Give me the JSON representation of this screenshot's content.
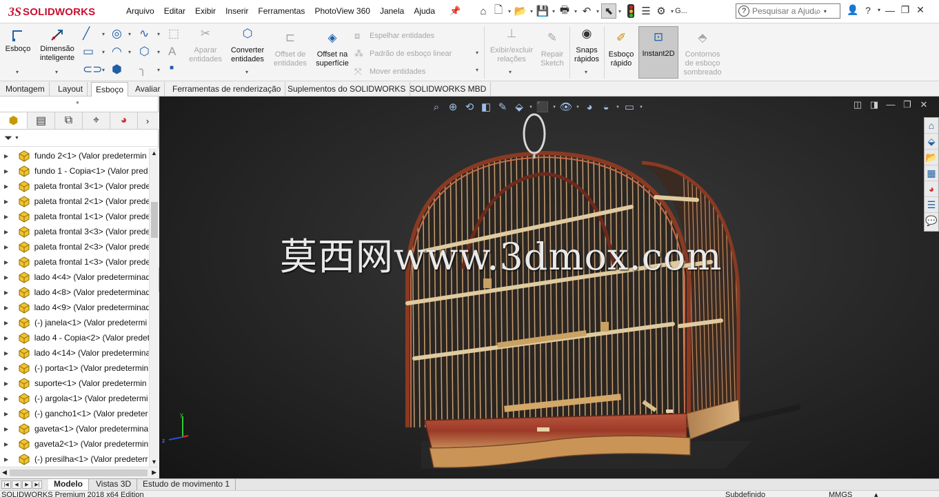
{
  "app": {
    "logo_ds": "3S",
    "logo_name": "SOLIDWORKS"
  },
  "menu": [
    "Arquivo",
    "Editar",
    "Exibir",
    "Inserir",
    "Ferramentas",
    "PhotoView 360",
    "Janela",
    "Ajuda"
  ],
  "search": {
    "placeholder": "Pesquisar a Ajuda"
  },
  "quick_access_trailing": "G...",
  "ribbon": {
    "esboco": "Esboço",
    "dimensao": "Dimensão inteligente",
    "aparar": "Aparar entidades",
    "converter": "Converter entidades",
    "offset_entidades": "Offset de entidades",
    "offset_superficie": "Offset na superfície",
    "espelhar": "Espelhar entidades",
    "padrao": "Padrão de esboço linear",
    "mover": "Mover entidades",
    "exibir_relacoes": "Exibir/excluir relações",
    "repair": "Repair Sketch",
    "snaps": "Snaps rápidos",
    "esboco_rapido": "Esboço rápido",
    "instant2d": "Instant2D",
    "contornos": "Contornos de esboço sombreado"
  },
  "command_tabs": [
    "Montagem",
    "Layout",
    "Esboço",
    "Avaliar",
    "Ferramentas de renderização",
    "Suplementos do SOLIDWORKS",
    "SOLIDWORKS MBD"
  ],
  "active_command_tab": "Esboço",
  "tree": {
    "items": [
      "fundo 2<1> (Valor predetermin",
      "fundo 1 - Copia<1> (Valor pred",
      "paleta frontal 3<1> (Valor prede",
      "paleta frontal 2<1> (Valor prede",
      "paleta frontal 1<1> (Valor prede",
      "paleta frontal 3<3> (Valor prede",
      "paleta frontal 2<3> (Valor prede",
      "paleta frontal 1<3> (Valor prede",
      "lado 4<4> (Valor predeterminad",
      "lado 4<8> (Valor predeterminad",
      "lado 4<9> (Valor predeterminad",
      "(-) janela<1> (Valor predetermi",
      "lado 4 - Copia<2> (Valor predet",
      "lado 4<14> (Valor predetermina",
      "(-) porta<1> (Valor predetermin",
      "suporte<1> (Valor predetermin",
      "(-) argola<1> (Valor predetermi",
      "(-) gancho1<1> (Valor predeter",
      "gaveta<1> (Valor predetermina",
      "gaveta2<1> (Valor predetermin",
      "(-) presilha<1> (Valor predeterr"
    ]
  },
  "viewport": {
    "watermark": "莫西网www.3dmox.com"
  },
  "bottom_tabs": [
    "Modelo",
    "Vistas 3D",
    "Estudo de movimento 1"
  ],
  "active_bottom_tab": "Modelo",
  "status": {
    "edition": "SOLIDWORKS Premium 2018 x64 Edition",
    "state": "Subdefinido",
    "units": "MMGS"
  },
  "colors": {
    "brand": "#c8102e",
    "accent": "#1f5fa8",
    "viewport_bg": "#262626",
    "cage_frame": "#8a3a22",
    "cage_wood": "#c9a263"
  }
}
